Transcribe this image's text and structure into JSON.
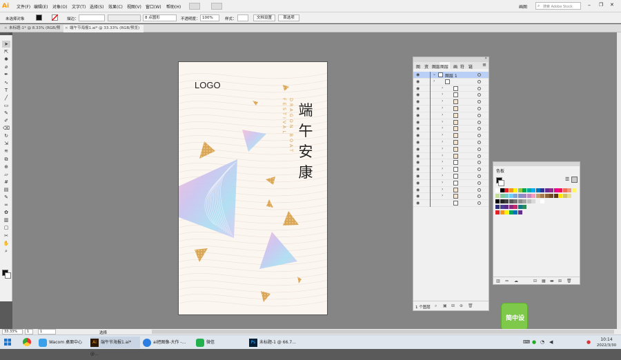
{
  "app": {
    "logo": "Ai"
  },
  "menu": [
    "文件(F)",
    "编辑(E)",
    "对象(O)",
    "文字(T)",
    "选择(S)",
    "效果(C)",
    "视图(V)",
    "窗口(W)",
    "帮助(H)"
  ],
  "workspace": {
    "label": "画图",
    "search_placeholder": "搜索 Adobe Stock"
  },
  "control_bar": {
    "selection": "未选择对象",
    "stroke_label": "描边：",
    "brush": "8 点圆形",
    "opacity_label": "不透明度：",
    "opacity": "100%",
    "style_label": "样式：",
    "doc_setup": "文档设置",
    "prefs": "首选项"
  },
  "tabs": [
    {
      "label": "未标题-1* @ 8.33% (RGB/预览)",
      "active": false
    },
    {
      "label": "端午节海报1.ai* @ 33.33% (RGB/预览)",
      "active": true
    }
  ],
  "tools": [
    "selection-tool",
    "direct-select-tool",
    "magic-wand-tool",
    "lasso-tool",
    "pen-tool",
    "curvature-tool",
    "type-tool",
    "line-tool",
    "rectangle-tool",
    "paintbrush-tool",
    "shaper-tool",
    "eraser-tool",
    "rotate-tool",
    "scale-tool",
    "width-tool",
    "free-transform-tool",
    "shape-builder-tool",
    "perspective-tool",
    "mesh-tool",
    "gradient-tool",
    "eyedropper-tool",
    "blend-tool",
    "symbol-tool",
    "graph-tool",
    "artboard-tool",
    "slice-tool",
    "hand-tool",
    "zoom-tool"
  ],
  "poster": {
    "logo": "LOGO",
    "title_chars": [
      "端",
      "午",
      "安",
      "康"
    ],
    "subtitle_line1": "DRAGON BOAT",
    "subtitle_line2": "FESTIVAL"
  },
  "layers_panel": {
    "tabs": [
      "图",
      "资",
      "图层",
      "画",
      "符",
      "链"
    ],
    "active_tab": "图层",
    "layer_name": "图层 1",
    "group_name": "…",
    "row_count": 20,
    "footer": "1 个图层"
  },
  "swatches_panel": {
    "title": "色板"
  },
  "status": {
    "zoom": "33.33%",
    "page": "1",
    "artboard_nav": "1",
    "tool": "选择"
  },
  "taskbar": {
    "items": [
      "Wacom 桌面中心",
      "端午节海报1.ai* @...",
      "ai把图像-大作 -...",
      "微信",
      "未标题-1 @ 66.7..."
    ],
    "time": "10:14",
    "date": "2022/3/30"
  },
  "watermark": {
    "text": "简中设"
  }
}
